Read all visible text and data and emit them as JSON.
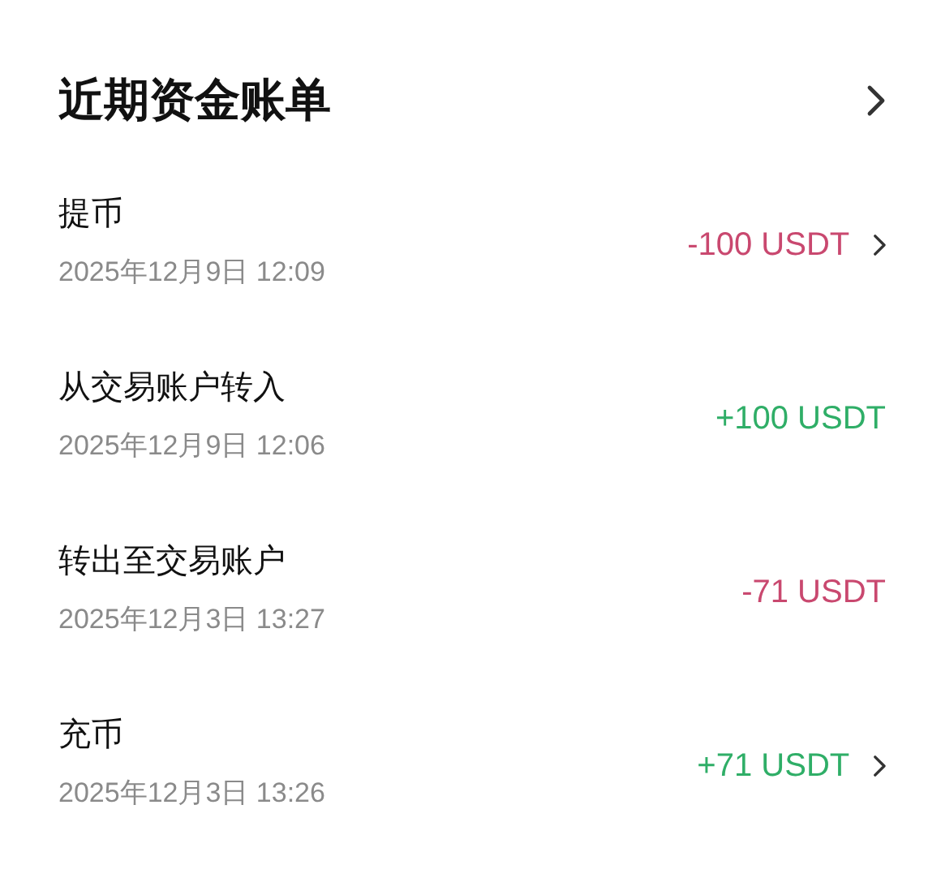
{
  "header": {
    "title": "近期资金账单"
  },
  "records": [
    {
      "name": "提币",
      "time": "2025年12月9日 12:09",
      "amount": "-100 USDT",
      "color": "#c9486f",
      "chevron": true
    },
    {
      "name": "从交易账户转入",
      "time": "2025年12月9日 12:06",
      "amount": "+100 USDT",
      "color": "#2fae67",
      "chevron": false
    },
    {
      "name": "转出至交易账户",
      "time": "2025年12月3日 13:27",
      "amount": "-71 USDT",
      "color": "#c9486f",
      "chevron": false
    },
    {
      "name": "充币",
      "time": "2025年12月3日 13:26",
      "amount": "+71 USDT",
      "color": "#2fae67",
      "chevron": true
    }
  ]
}
